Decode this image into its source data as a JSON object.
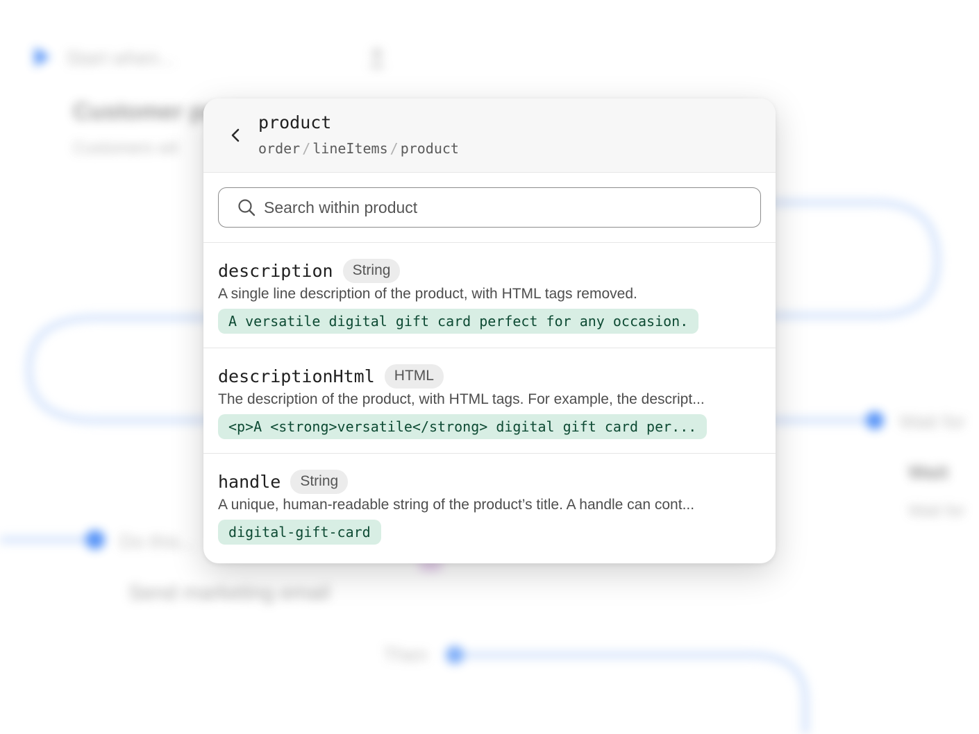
{
  "background": {
    "start_label": "Start when...",
    "trigger_title": "Customer pu",
    "trigger_subtitle": "Customers wit",
    "do_this_label": "Do this...",
    "action_title": "Send marketing email",
    "then_label": "Then",
    "right_label": "Wait for",
    "right_title": "Wait",
    "right_subtitle": "Wait for"
  },
  "header": {
    "back_icon": "chevron-left-icon",
    "title": "product",
    "breadcrumb": [
      "order",
      "lineItems",
      "product"
    ],
    "separator": "/"
  },
  "search": {
    "icon": "search-icon",
    "placeholder": "Search within product",
    "value": ""
  },
  "items": [
    {
      "name": "description",
      "type": "String",
      "description": "A single line description of the product, with HTML tags removed.",
      "example": "A versatile digital gift card perfect for any occasion."
    },
    {
      "name": "descriptionHtml",
      "type": "HTML",
      "description": "The description of the product, with HTML tags. For example, the descript...",
      "example": "<p>A <strong>versatile</strong> digital gift card per..."
    },
    {
      "name": "handle",
      "type": "String",
      "description": "A unique, human-readable string of the product’s title. A handle can cont...",
      "example": "digital-gift-card"
    }
  ],
  "colors": {
    "accent_blue": "#3b82f6",
    "example_bg": "#d8eee4",
    "example_text": "#0d4a33"
  }
}
